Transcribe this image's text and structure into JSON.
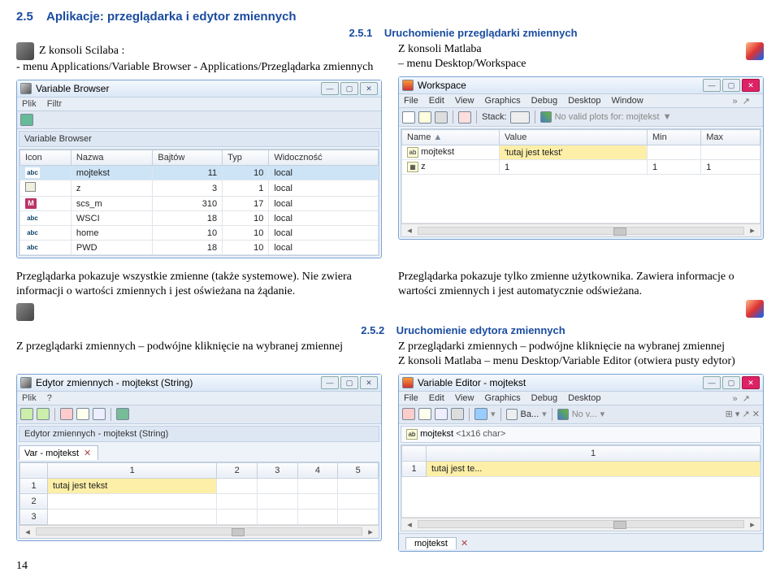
{
  "section": {
    "num": "2.5",
    "title": "Aplikacje: przeglądarka i edytor zmiennych",
    "sub1": {
      "num": "2.5.1",
      "title": "Uruchomienie przeglądarki zmiennych"
    },
    "sub2": {
      "num": "2.5.2",
      "title": "Uruchomienie edytora zmiennych"
    }
  },
  "intro": {
    "scilab": {
      "head": "Z konsoli Scilaba :",
      "line": "- menu Applications/Variable Browser - Applications/Przeglądarka zmiennych"
    },
    "matlab": {
      "head": "Z konsoli Matlaba",
      "line": "– menu Desktop/Workspace"
    }
  },
  "vb": {
    "title": "Variable Browser",
    "menu": {
      "m1": "Plik",
      "m2": "Filtr"
    },
    "panel": "Variable Browser",
    "headers": {
      "c1": "Icon",
      "c2": "Nazwa",
      "c3": "Bajtów",
      "c4": "Typ",
      "c5": "Widoczność"
    },
    "rows": [
      {
        "icon": "abc",
        "name": "mojtekst",
        "bytes": "11",
        "typ": "10",
        "vis": "local"
      },
      {
        "icon": "box",
        "name": "z",
        "bytes": "3",
        "typ": "1",
        "vis": "local"
      },
      {
        "icon": "M",
        "name": "scs_m",
        "bytes": "310",
        "typ": "17",
        "vis": "local"
      },
      {
        "icon": "abc",
        "name": "WSCI",
        "bytes": "18",
        "typ": "10",
        "vis": "local"
      },
      {
        "icon": "abc",
        "name": "home",
        "bytes": "10",
        "typ": "10",
        "vis": "local"
      },
      {
        "icon": "abc",
        "name": "PWD",
        "bytes": "18",
        "typ": "10",
        "vis": "local"
      }
    ]
  },
  "ws": {
    "title": "Workspace",
    "menu": {
      "m1": "File",
      "m2": "Edit",
      "m3": "View",
      "m4": "Graphics",
      "m5": "Debug",
      "m6": "Desktop",
      "m7": "Window"
    },
    "stack_lbl": "Stack:",
    "no_plots": "No valid plots for: mojtekst",
    "headers": {
      "c1": "Name",
      "c2": "Value",
      "c3": "Min",
      "c4": "Max"
    },
    "rows": [
      {
        "icon": "ab",
        "name": "mojtekst",
        "value": "'tutaj jest tekst'",
        "min": "",
        "max": ""
      },
      {
        "icon": "bx",
        "name": "z",
        "value": "1",
        "min": "1",
        "max": "1"
      }
    ]
  },
  "mid_desc": {
    "scilab": "Przeglądarka pokazuje wszystkie zmienne (także systemowe). Nie zwiera informacji o wartości zmiennych i jest oświeżana na żądanie.",
    "matlab": "Przeglądarka pokazuje tylko zmienne użytkownika. Zawiera informacje o wartości zmiennych i jest automatycznie odświeżana.",
    "scilab_action": "Z przeglądarki zmiennych – podwójne kliknięcie na wybranej zmiennej",
    "matlab_action1": "Z przeglądarki zmiennych – podwójne kliknięcie na wybranej zmiennej",
    "matlab_action2": "Z konsoli Matlaba – menu Desktop/Variable Editor (otwiera pusty edytor)"
  },
  "ed_sci": {
    "title": "Edytor zmiennych - mojtekst  (String)",
    "menu": {
      "m1": "Plik",
      "m2": "?"
    },
    "panel": "Edytor zmiennych - mojtekst  (String)",
    "tab": "Var - mojtekst",
    "cols": [
      "1",
      "2",
      "3",
      "4",
      "5"
    ],
    "rows": {
      "r1": "1",
      "r1v": "tutaj jest tekst",
      "r2": "2",
      "r3": "3"
    }
  },
  "ed_mat": {
    "title": "Variable Editor - mojtekst",
    "menu": {
      "m1": "File",
      "m2": "Edit",
      "m3": "View",
      "m4": "Graphics",
      "m5": "Debug",
      "m6": "Desktop"
    },
    "ba": "Ba...",
    "nov": "No v...",
    "tab": "mojtekst",
    "dim": "<1x16 char>",
    "col1": "1",
    "row1": "1",
    "cell": "tutaj jest te..."
  },
  "page": "14"
}
